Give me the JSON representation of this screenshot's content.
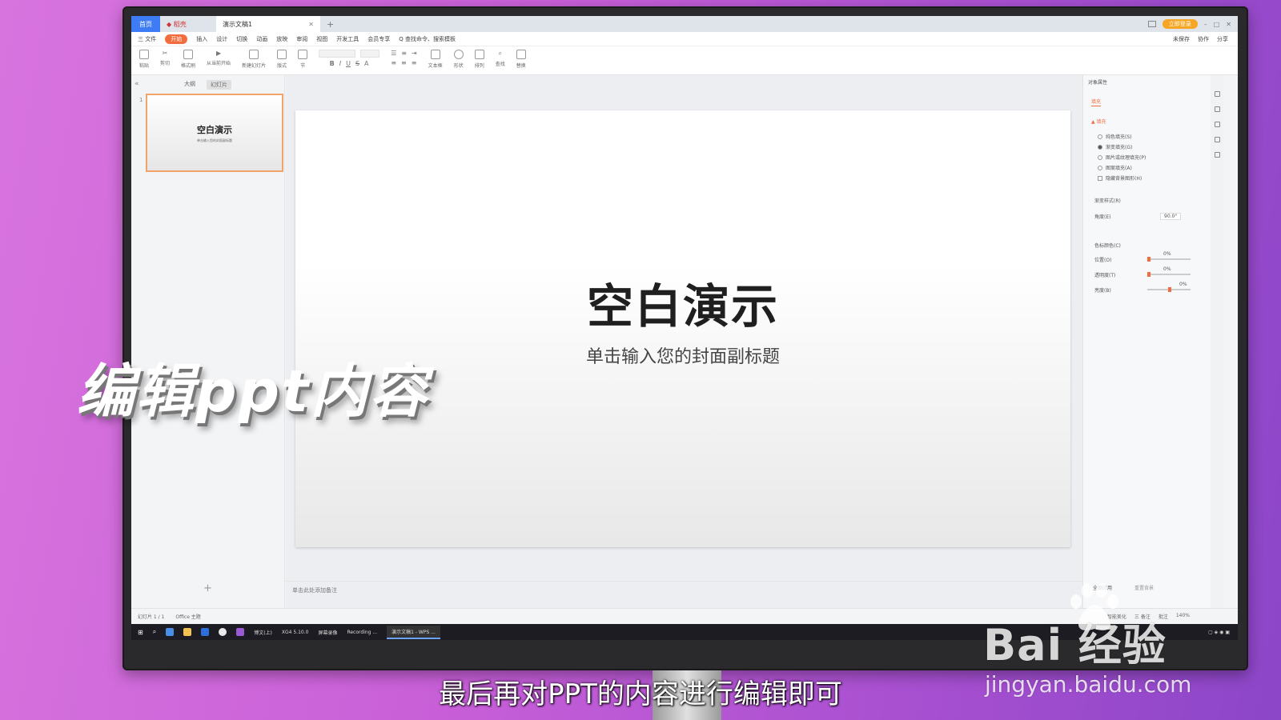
{
  "window": {
    "tabs": [
      {
        "label": "首页"
      },
      {
        "label": "稻壳"
      },
      {
        "label": "演示文稿1"
      }
    ],
    "login_label": "立即登录"
  },
  "menu": {
    "items": [
      "三 文件",
      "开始",
      "插入",
      "设计",
      "切换",
      "动画",
      "放映",
      "审阅",
      "视图",
      "开发工具",
      "会员专享",
      "Q 查找命令、搜索模板"
    ],
    "active_index": 1,
    "right_items": [
      "未保存",
      "协作",
      "分享"
    ]
  },
  "ribbon": {
    "groups": [
      "粘贴",
      "剪切",
      "格式刷",
      "从当前开始",
      "新建幻灯片",
      "版式",
      "节",
      "文本框",
      "形状",
      "排列",
      "查找",
      "替换"
    ]
  },
  "left_panel": {
    "tabs": [
      "大纲",
      "幻灯片"
    ],
    "slide_number": "1",
    "thumb_title": "空白演示",
    "thumb_subtitle": "单击输入您的封面副标题"
  },
  "slide": {
    "title": "空白演示",
    "subtitle": "单击输入您的封面副标题"
  },
  "notes_placeholder": "单击此处添加备注",
  "right_panel": {
    "title": "对象属性",
    "tab": "填充",
    "section": "▲ 填充",
    "options": [
      {
        "label": "纯色填充(S)",
        "selected": false
      },
      {
        "label": "渐变填充(G)",
        "selected": true
      },
      {
        "label": "图片或纹理填充(P)",
        "selected": false
      },
      {
        "label": "图案填充(A)",
        "selected": false
      },
      {
        "label": "隐藏背景图形(H)",
        "selected": false
      }
    ],
    "gradient_style_label": "渐变样式(R)",
    "angle_label": "角度(E)",
    "angle_value": "90.0°",
    "stop_color_label": "色标颜色(C)",
    "sliders": [
      {
        "label": "位置(O)",
        "value": "0%"
      },
      {
        "label": "透明度(T)",
        "value": "0%"
      },
      {
        "label": "亮度(B)",
        "value": "0%"
      }
    ],
    "apply_all_label": "全部应用",
    "reset_label": "重置背景"
  },
  "status": {
    "slide_count": "幻灯片 1 / 1",
    "theme": "Office 主题",
    "right_items": [
      "智能美化",
      "三 备注",
      "批注"
    ],
    "zoom": "140%"
  },
  "taskbar": {
    "items": [
      "博文(上)",
      "XG4 5.10.0",
      "屏幕录像",
      "Recording ...",
      "演示文稿1 - WPS ..."
    ]
  },
  "overlay": {
    "caption": "编辑ppt内容",
    "subtitle": "最后再对PPT的内容进行编辑即可"
  },
  "watermark": {
    "logo": "Bai 经验",
    "url": "jingyan.baidu.com"
  },
  "colors": {
    "accent_orange": "#f36c3d",
    "tab_blue": "#3d7cf5",
    "background_purple": "#c85fd8"
  }
}
